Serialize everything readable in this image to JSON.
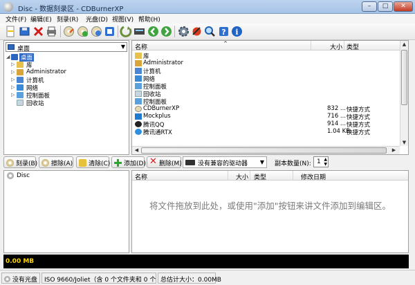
{
  "window": {
    "title": "Disc - 数据刻录区 - CDBurnerXP",
    "minimize": "–",
    "maximize": "□",
    "close": "✕"
  },
  "menu": [
    "文件(F)",
    "编辑(E)",
    "刻录(R)",
    "光盘(D)",
    "视图(V)",
    "帮助(H)"
  ],
  "toolbar_icons": [
    "new-icon",
    "open-icon",
    "delete-icon",
    "print-icon",
    "burn-icon",
    "erase-icon",
    "copy-icon",
    "disc-info-icon",
    "back-icon",
    "forward-icon",
    "settings-icon",
    "plugin-icon",
    "search-icon",
    "help-icon",
    "info-icon"
  ],
  "tree": {
    "location": "桌面",
    "items": [
      {
        "label": "桌面",
        "icon": "desktop-icon"
      },
      {
        "label": "库",
        "icon": "library-icon"
      },
      {
        "label": "Administrator",
        "icon": "user-folder-icon"
      },
      {
        "label": "计算机",
        "icon": "computer-icon"
      },
      {
        "label": "网络",
        "icon": "network-icon"
      },
      {
        "label": "控制面板",
        "icon": "control-panel-icon"
      },
      {
        "label": "回收站",
        "icon": "recycle-bin-icon"
      }
    ]
  },
  "files": {
    "columns": {
      "name": "名称",
      "size": "大小",
      "type": "类型"
    },
    "rows": [
      {
        "name": "库",
        "size": "",
        "type": "",
        "icon": "library-icon"
      },
      {
        "name": "Administrator",
        "size": "",
        "type": "",
        "icon": "user-folder-icon"
      },
      {
        "name": "计算机",
        "size": "",
        "type": "",
        "icon": "computer-icon"
      },
      {
        "name": "网络",
        "size": "",
        "type": "",
        "icon": "network-icon"
      },
      {
        "name": "控制面板",
        "size": "",
        "type": "",
        "icon": "control-panel-icon"
      },
      {
        "name": "回收站",
        "size": "",
        "type": "",
        "icon": "recycle-bin-icon"
      },
      {
        "name": "控制面板",
        "size": "",
        "type": "",
        "icon": "control-panel-icon"
      },
      {
        "name": "CDBurnerXP",
        "size": "832 ...",
        "type": "快捷方式",
        "icon": "app-shortcut-icon"
      },
      {
        "name": "Mockplus",
        "size": "716 ...",
        "type": "快捷方式",
        "icon": "app-shortcut-icon"
      },
      {
        "name": "腾讯QQ",
        "size": "914 ...",
        "type": "快捷方式",
        "icon": "qq-icon"
      },
      {
        "name": "腾讯通RTX",
        "size": "1.04 KB",
        "type": "快捷方式",
        "icon": "rtx-icon"
      }
    ]
  },
  "actions": {
    "burn": "刻录(B)",
    "erase": "擦除(A)",
    "clear": "清除(C)",
    "add": "添加(D)",
    "remove": "删除(M)",
    "drive": "没有兼容的驱动器",
    "copies_label": "副本数量(N):",
    "copies_value": "1"
  },
  "compilation": {
    "root": "Disc",
    "columns": {
      "name": "名称",
      "size": "大小",
      "type": "类型",
      "modified": "修改日期"
    },
    "empty_hint": "将文件拖放到此处，或使用\"添加\"按钮来讲文件添加到编辑区。"
  },
  "capacity": {
    "used": "0.00 MB"
  },
  "status": {
    "disc": "没有光盘",
    "filesystem": "ISO 9660/Joliet（含 0 个文件夹和 0 个文件）",
    "total": "总估计大小：0.00MB"
  }
}
